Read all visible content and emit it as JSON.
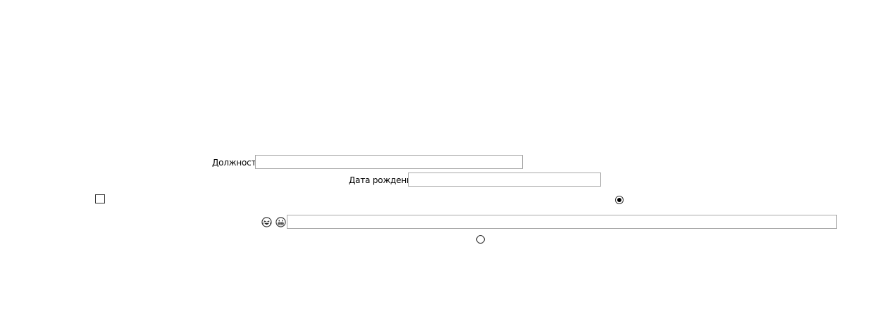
{
  "form": {
    "position_label": "Должность",
    "position_value": "",
    "birthdate_label": "Дата рождения",
    "birthdate_value": "",
    "checkbox_checked": false,
    "radio_selected_checked": true,
    "radio_unselected_checked": false,
    "wide_field_value": ""
  },
  "icons": {
    "first": "laughing-face-icon",
    "second": "grinning-face-icon"
  }
}
